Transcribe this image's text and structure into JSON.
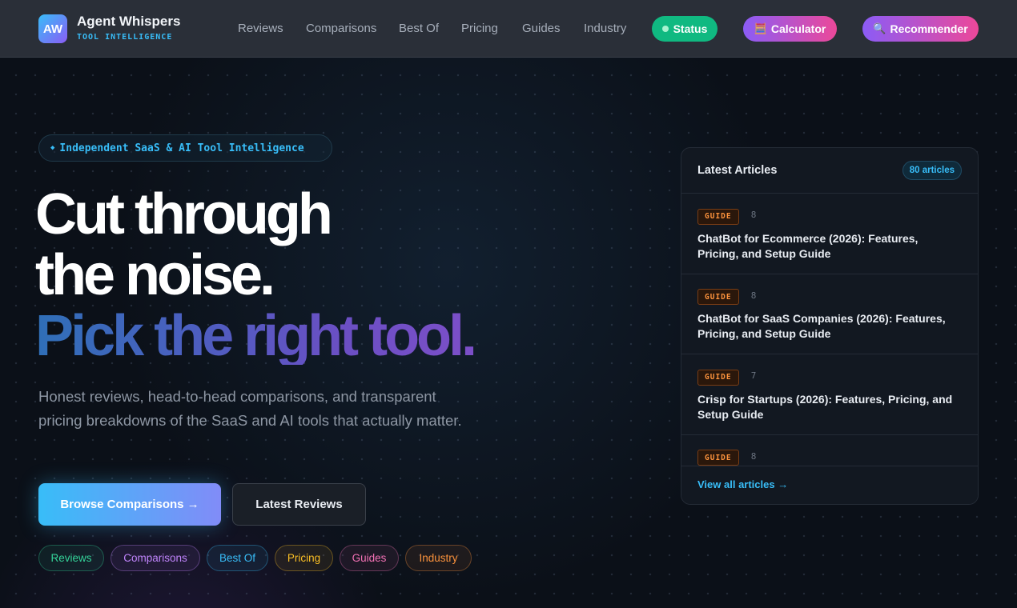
{
  "brand": {
    "logo": "AW",
    "name": "Agent Whispers",
    "tagline": "TOOL INTELLIGENCE"
  },
  "nav": {
    "links": [
      "Reviews",
      "Comparisons",
      "Best Of",
      "Pricing",
      "Guides",
      "Industry"
    ],
    "status_label": "Status",
    "calculator_label": "Calculator",
    "calculator_icon": "🧮",
    "recommender_label": "Recommender",
    "recommender_icon": "🔍"
  },
  "hero": {
    "badge": "Independent SaaS & AI Tool Intelligence",
    "badge_icon": "◆",
    "headline_1": "Cut through",
    "headline_2": "the noise.",
    "headline_3": "Pick the right tool.",
    "lead": "Honest reviews, head-to-head comparisons, and transparent pricing breakdowns of the SaaS and AI tools that actually matter.",
    "cta_primary": "Browse Comparisons →",
    "cta_secondary": "Latest Reviews"
  },
  "chips": [
    {
      "label": "Reviews",
      "color": "#34d399"
    },
    {
      "label": "Comparisons",
      "color": "#c084fc"
    },
    {
      "label": "Best Of",
      "color": "#38bdf8"
    },
    {
      "label": "Pricing",
      "color": "#fbbf24"
    },
    {
      "label": "Guides",
      "color": "#f472b6"
    },
    {
      "label": "Industry",
      "color": "#fb923c"
    }
  ],
  "articles_panel": {
    "title": "Latest Articles",
    "count": "80 articles",
    "items": [
      {
        "tag": "GUIDE",
        "read": "8",
        "title": "ChatBot for Ecommerce (2026): Features, Pricing, and Setup Guide"
      },
      {
        "tag": "GUIDE",
        "read": "8",
        "title": "ChatBot for SaaS Companies (2026): Features, Pricing, and Setup Guide"
      },
      {
        "tag": "GUIDE",
        "read": "7",
        "title": "Crisp for Startups (2026): Features, Pricing, and Setup Guide"
      },
      {
        "tag": "GUIDE",
        "read": "8",
        "title": ""
      }
    ],
    "view_all": "View all articles →"
  },
  "colors": {
    "accent": "#38bdf8",
    "purple": "#8b5cf6",
    "pink": "#ec4899",
    "status_green": "#10b981",
    "nav_bg": "#2a2f38",
    "page_bg": "#0b1018"
  }
}
